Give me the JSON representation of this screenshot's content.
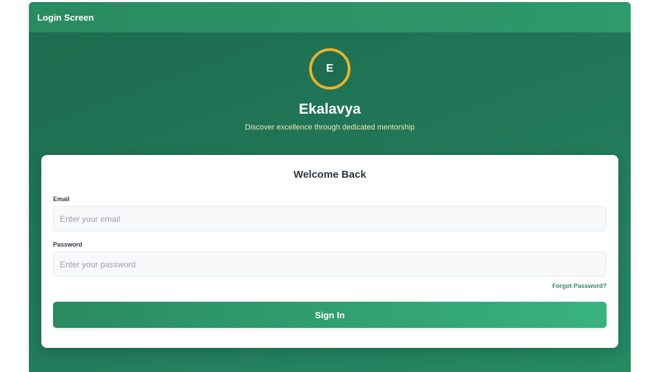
{
  "window": {
    "title": "Login Screen"
  },
  "brand": {
    "logo_letter": "E",
    "name": "Ekalavya",
    "tagline": "Discover excellence through dedicated mentorship"
  },
  "card": {
    "title": "Welcome Back",
    "email": {
      "label": "Email",
      "placeholder": "Enter your email",
      "value": ""
    },
    "password": {
      "label": "Password",
      "placeholder": "Enter your password",
      "value": ""
    },
    "forgot_label": "Forgot Password?",
    "signin_label": "Sign In"
  },
  "colors": {
    "primary_green": "#2a8a62",
    "accent_gold": "#e8b22c",
    "tagline_cream": "#f3e7b8"
  }
}
